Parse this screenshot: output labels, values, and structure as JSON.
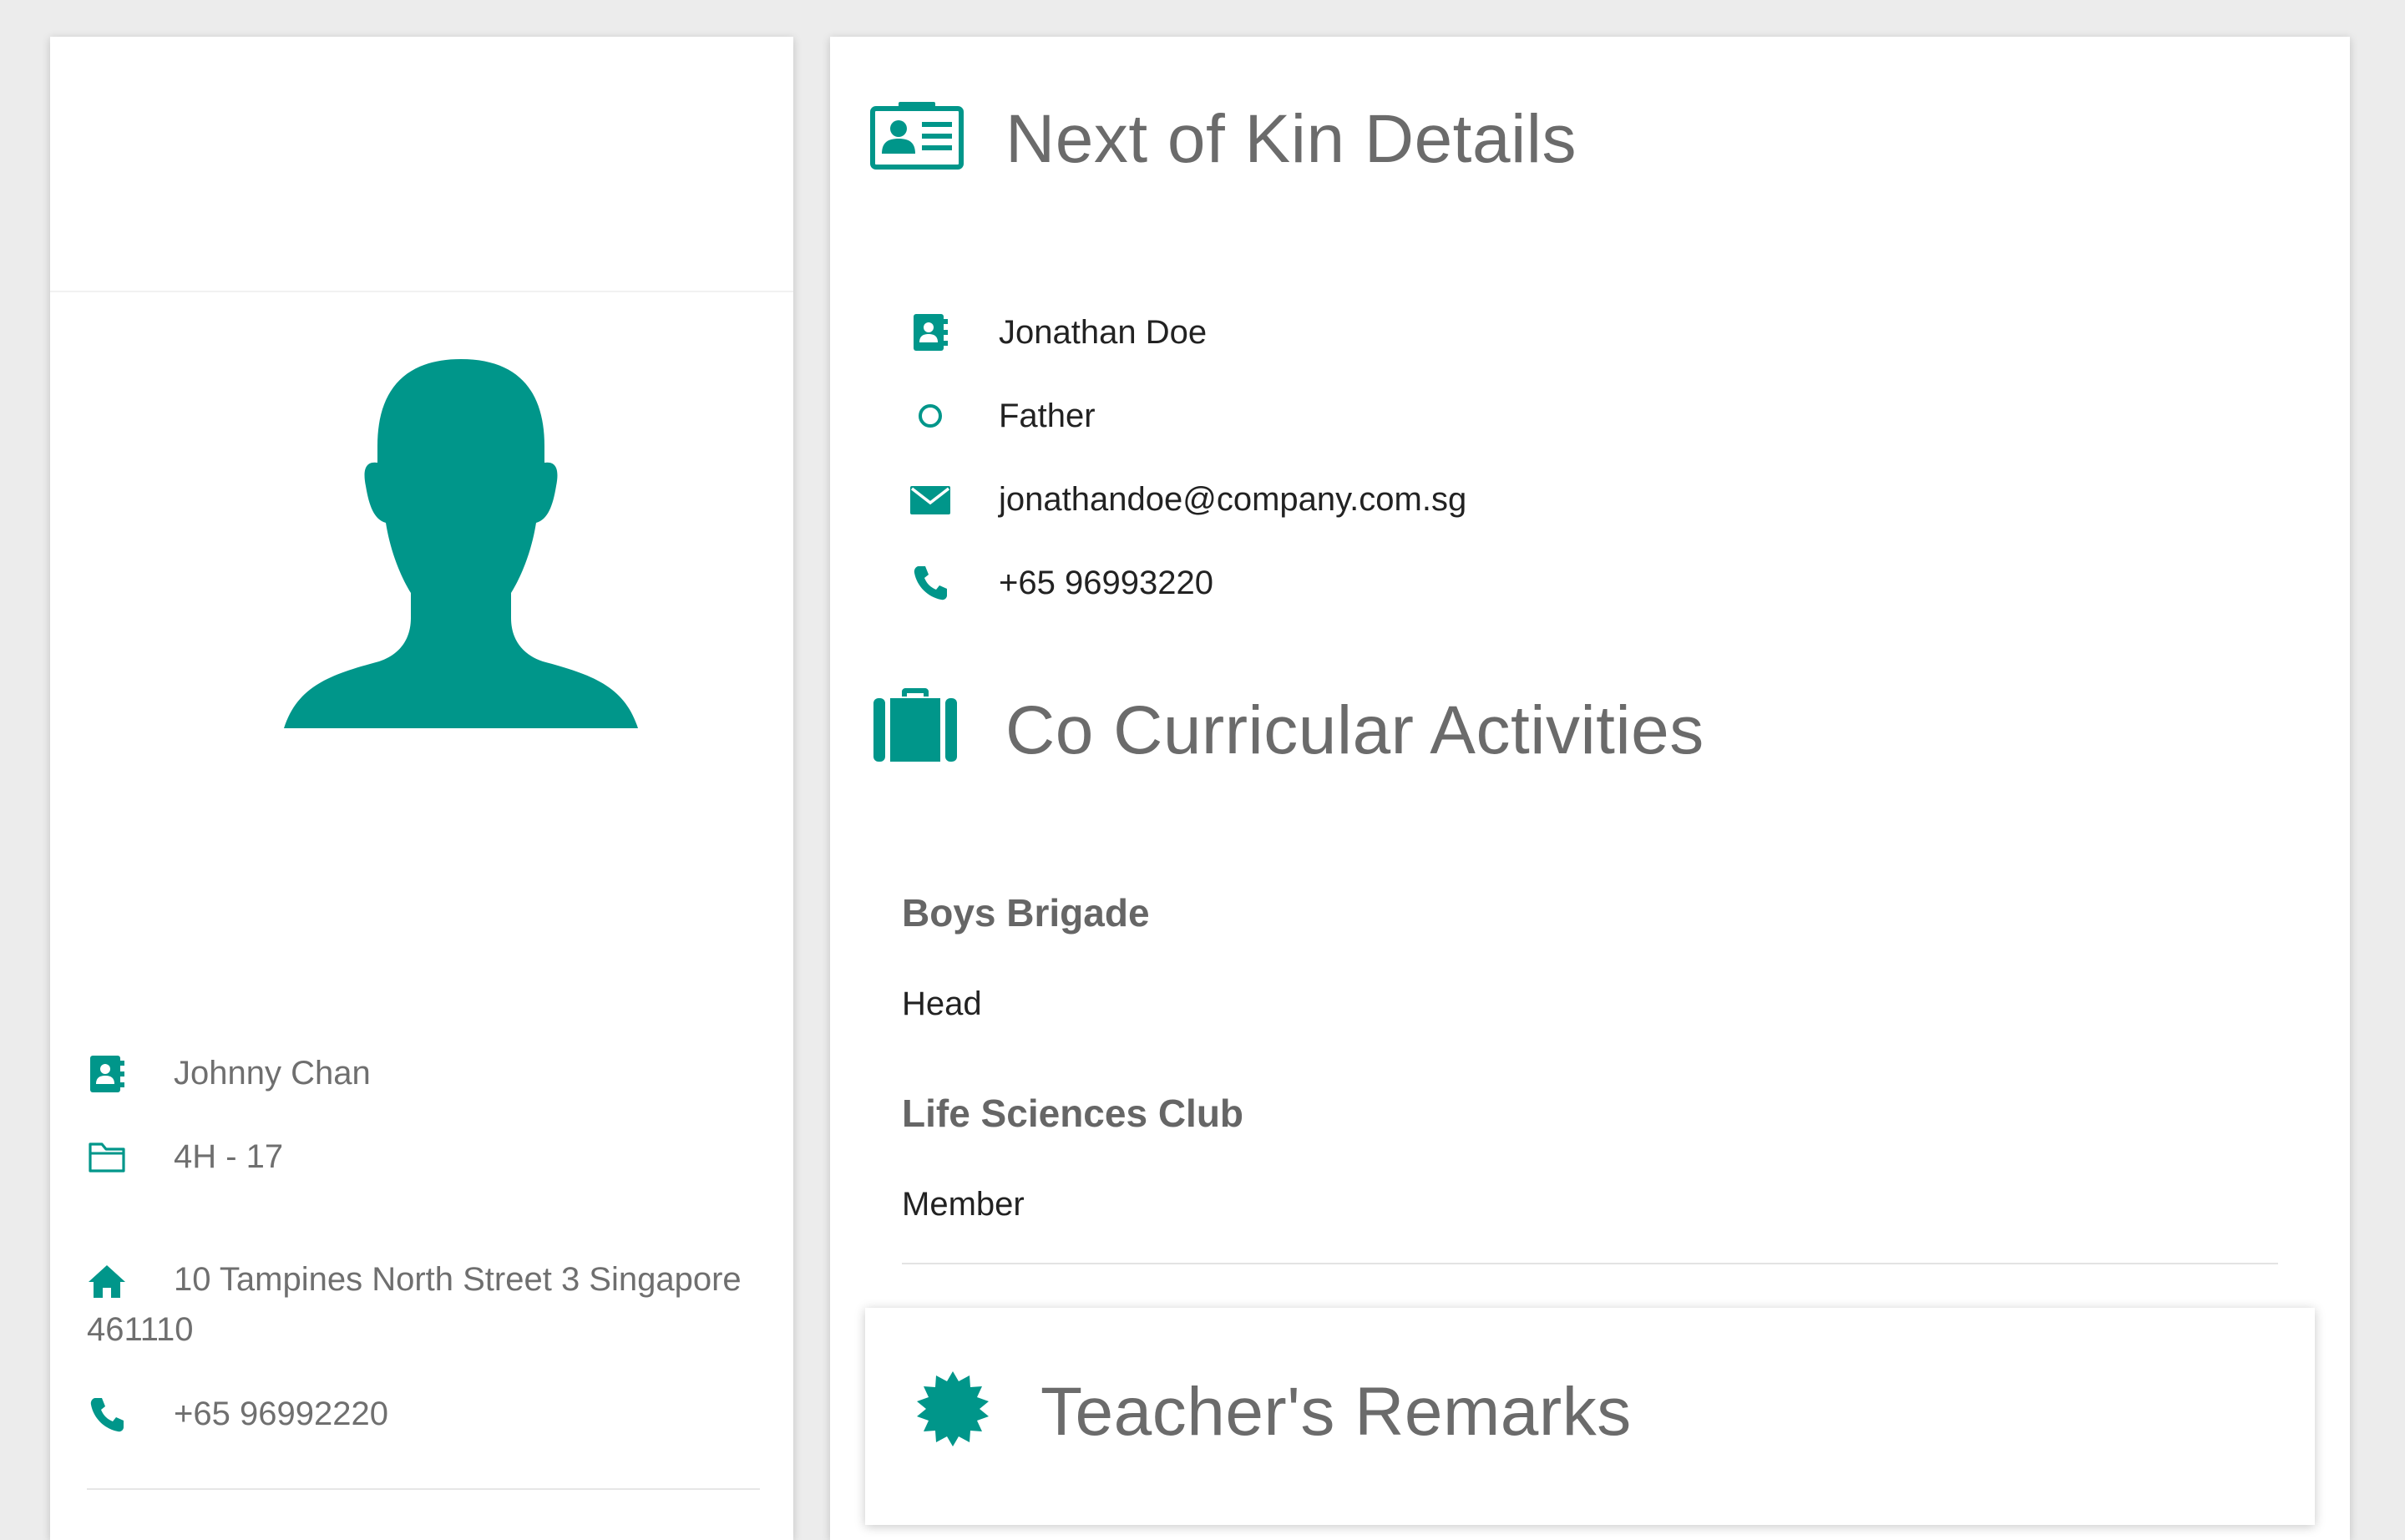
{
  "colors": {
    "accent": "#00968a",
    "title_text": "#6b6b6b",
    "body_text": "#222222"
  },
  "profile": {
    "avatar_icon": "person-silhouette",
    "name": "Johnny Chan",
    "class": "4H - 17",
    "address": "10 Tampines North Street 3 Singapore 461110",
    "phone": "+65 96992220"
  },
  "next_of_kin": {
    "title": "Next of Kin Details",
    "icon": "id-card-icon",
    "name": "Jonathan Doe",
    "relationship": "Father",
    "email": "jonathandoe@company.com.sg",
    "phone": "+65 96993220"
  },
  "cca": {
    "title": "Co Curricular Activities",
    "icon": "briefcase-icon",
    "items": [
      {
        "name": "Boys Brigade",
        "role": "Head"
      },
      {
        "name": "Life Sciences Club",
        "role": "Member"
      }
    ]
  },
  "remarks": {
    "title": "Teacher's Remarks",
    "icon": "badge-icon"
  }
}
